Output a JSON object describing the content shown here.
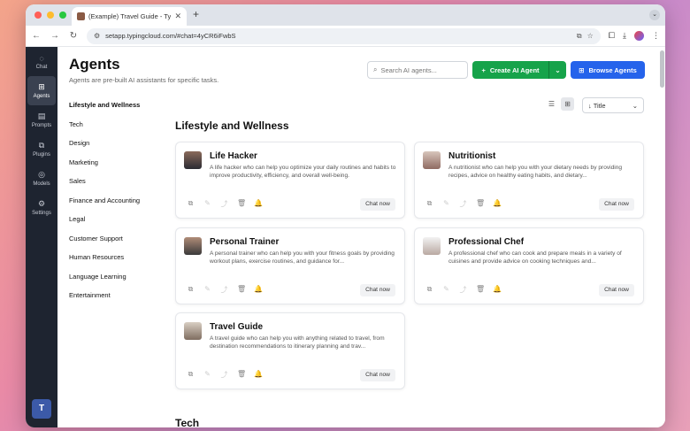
{
  "browser": {
    "tab_title": "(Example) Travel Guide - Typ",
    "url": "setapp.typingcloud.com/#chat=4yCR6iFwbS"
  },
  "rail": {
    "items": [
      {
        "label": "Chat",
        "icon": "chat-icon"
      },
      {
        "label": "Agents",
        "icon": "agents-icon",
        "active": true
      },
      {
        "label": "Prompts",
        "icon": "prompts-icon"
      },
      {
        "label": "Plugins",
        "icon": "plugins-icon"
      },
      {
        "label": "Models",
        "icon": "models-icon"
      },
      {
        "label": "Settings",
        "icon": "gear-icon"
      }
    ],
    "avatar_letter": "T"
  },
  "header": {
    "title": "Agents",
    "subtitle": "Agents are pre-built AI assistants for specific tasks.",
    "search_placeholder": "Search AI agents...",
    "create_label": "Create AI Agent",
    "browse_label": "Browse Agents"
  },
  "sort": {
    "label": "↓ Title"
  },
  "categories": [
    "Lifestyle and Wellness",
    "Tech",
    "Design",
    "Marketing",
    "Sales",
    "Finance and Accounting",
    "Legal",
    "Customer Support",
    "Human Resources",
    "Language Learning",
    "Entertainment"
  ],
  "sections": [
    {
      "title": "Lifestyle and Wellness",
      "cards": [
        {
          "name": "Life Hacker",
          "desc": "A life hacker who can help you optimize your daily routines and habits to improve productivity, efficiency, and overall well-being.",
          "chat": "Chat now"
        },
        {
          "name": "Nutritionist",
          "desc": "A nutritionist who can help you with your dietary needs by providing recipes, advice on healthy eating habits, and dietary...",
          "chat": "Chat now"
        },
        {
          "name": "Personal Trainer",
          "desc": "A personal trainer who can help you with your fitness goals by providing workout plans, exercise routines, and guidance for...",
          "chat": "Chat now"
        },
        {
          "name": "Professional Chef",
          "desc": "A professional chef who can cook and prepare meals in a variety of cuisines and provide advice on cooking techniques and...",
          "chat": "Chat now"
        },
        {
          "name": "Travel Guide",
          "desc": "A travel guide who can help you with anything related to travel, from destination recommendations to itinerary planning and trav...",
          "chat": "Chat now"
        }
      ]
    },
    {
      "title": "Tech"
    }
  ],
  "colors": {
    "create": "#16a34a",
    "browse": "#2563eb",
    "rail": "#1e2430"
  }
}
